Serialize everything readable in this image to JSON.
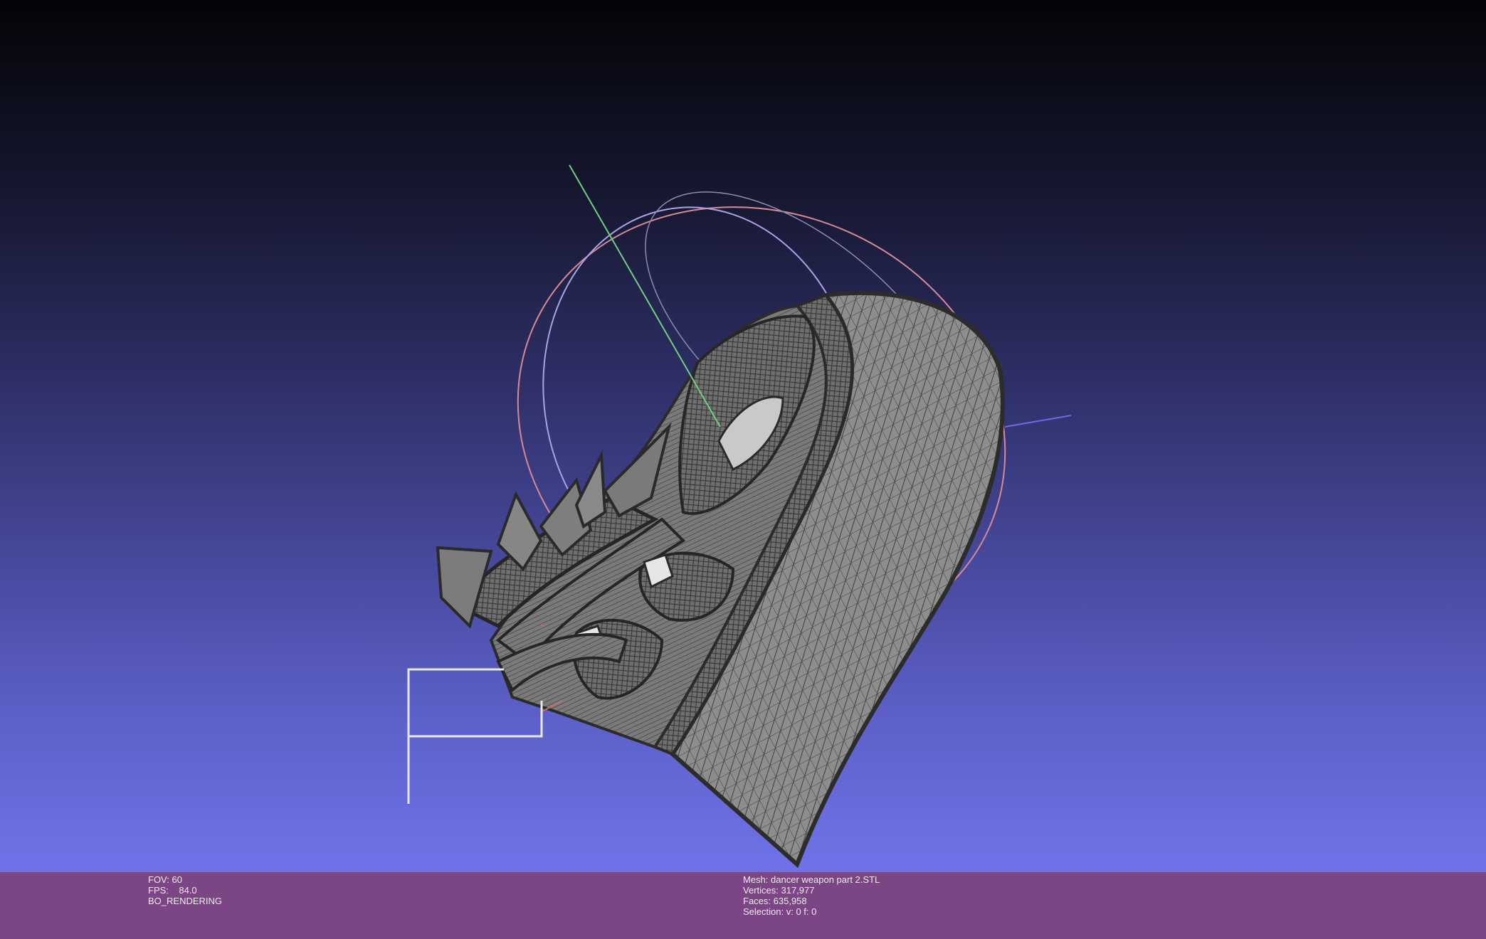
{
  "viewer": {
    "background_top": "#040407",
    "background_bottom": "#7073e8",
    "status_bar_color": "#7c4585",
    "text_color": "#ececec"
  },
  "render_info": {
    "fov_label": "FOV:",
    "fov_value": "60",
    "fps_label": "FPS:",
    "fps_value": "84.0",
    "mode": "BO_RENDERING"
  },
  "mesh_info": {
    "mesh_label": "Mesh:",
    "mesh_name": "dancer weapon part 2.STL",
    "vertices_label": "Vertices:",
    "vertices_value": "317,977",
    "faces_label": "Faces:",
    "faces_value": "635,958",
    "selection_label": "Selection:",
    "selection_value": "v: 0 f: 0"
  },
  "trackball": {
    "x_axis_color": "#e07070",
    "y_axis_color": "#70e070",
    "z_axis_color": "#6a6ae8"
  },
  "mesh_render": {
    "fill_color": "#8c8c8c",
    "wire_color": "#3a3a3a"
  }
}
